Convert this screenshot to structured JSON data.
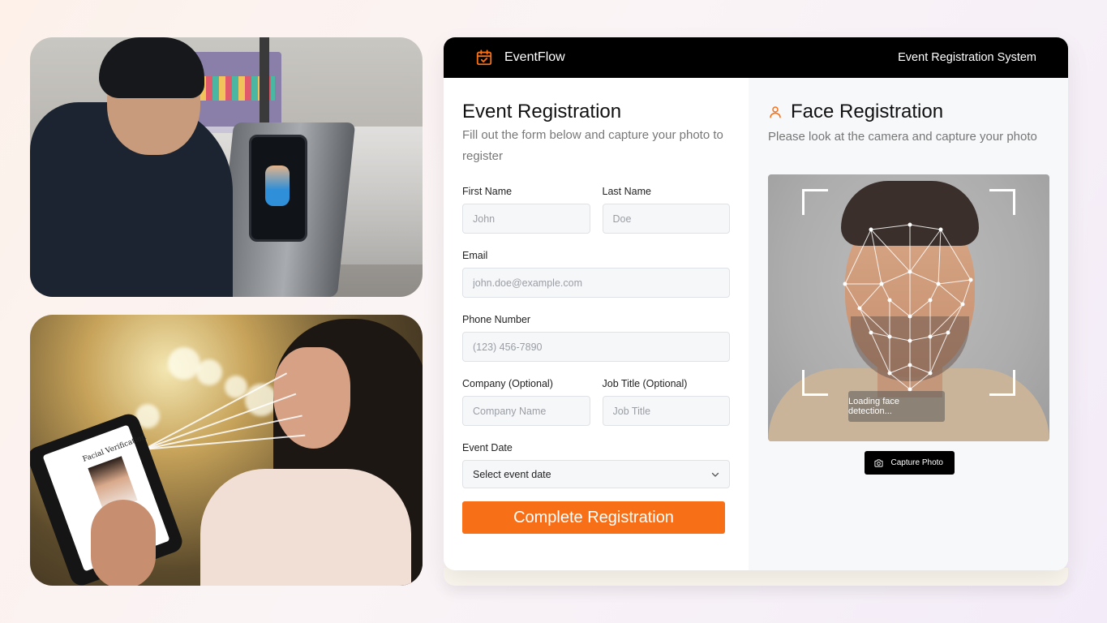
{
  "header": {
    "brand": "EventFlow",
    "subtitle": "Event Registration System",
    "accent": "#f77018"
  },
  "form": {
    "title": "Event Registration",
    "description": "Fill out the form below and capture your photo to register",
    "fields": {
      "first_name": {
        "label": "First Name",
        "placeholder": "John"
      },
      "last_name": {
        "label": "Last Name",
        "placeholder": "Doe"
      },
      "email": {
        "label": "Email",
        "placeholder": "john.doe@example.com"
      },
      "phone": {
        "label": "Phone Number",
        "placeholder": "(123) 456-7890"
      },
      "company": {
        "label": "Company (Optional)",
        "placeholder": "Company Name"
      },
      "job_title": {
        "label": "Job Title (Optional)",
        "placeholder": "Job Title"
      },
      "event_date": {
        "label": "Event Date",
        "value": "Select event date"
      }
    },
    "submit_label": "Complete Registration"
  },
  "face": {
    "title": "Face Registration",
    "instruction": "Please look at the camera and capture your photo",
    "status": "Loading face detection...",
    "capture_label": "Capture Photo"
  },
  "photos": {
    "tablet_caption": "Facial Verification"
  },
  "icons": {
    "brand": "calendar-check-icon",
    "face": "user-icon",
    "capture": "camera-icon",
    "date": "chevron-down-icon"
  }
}
